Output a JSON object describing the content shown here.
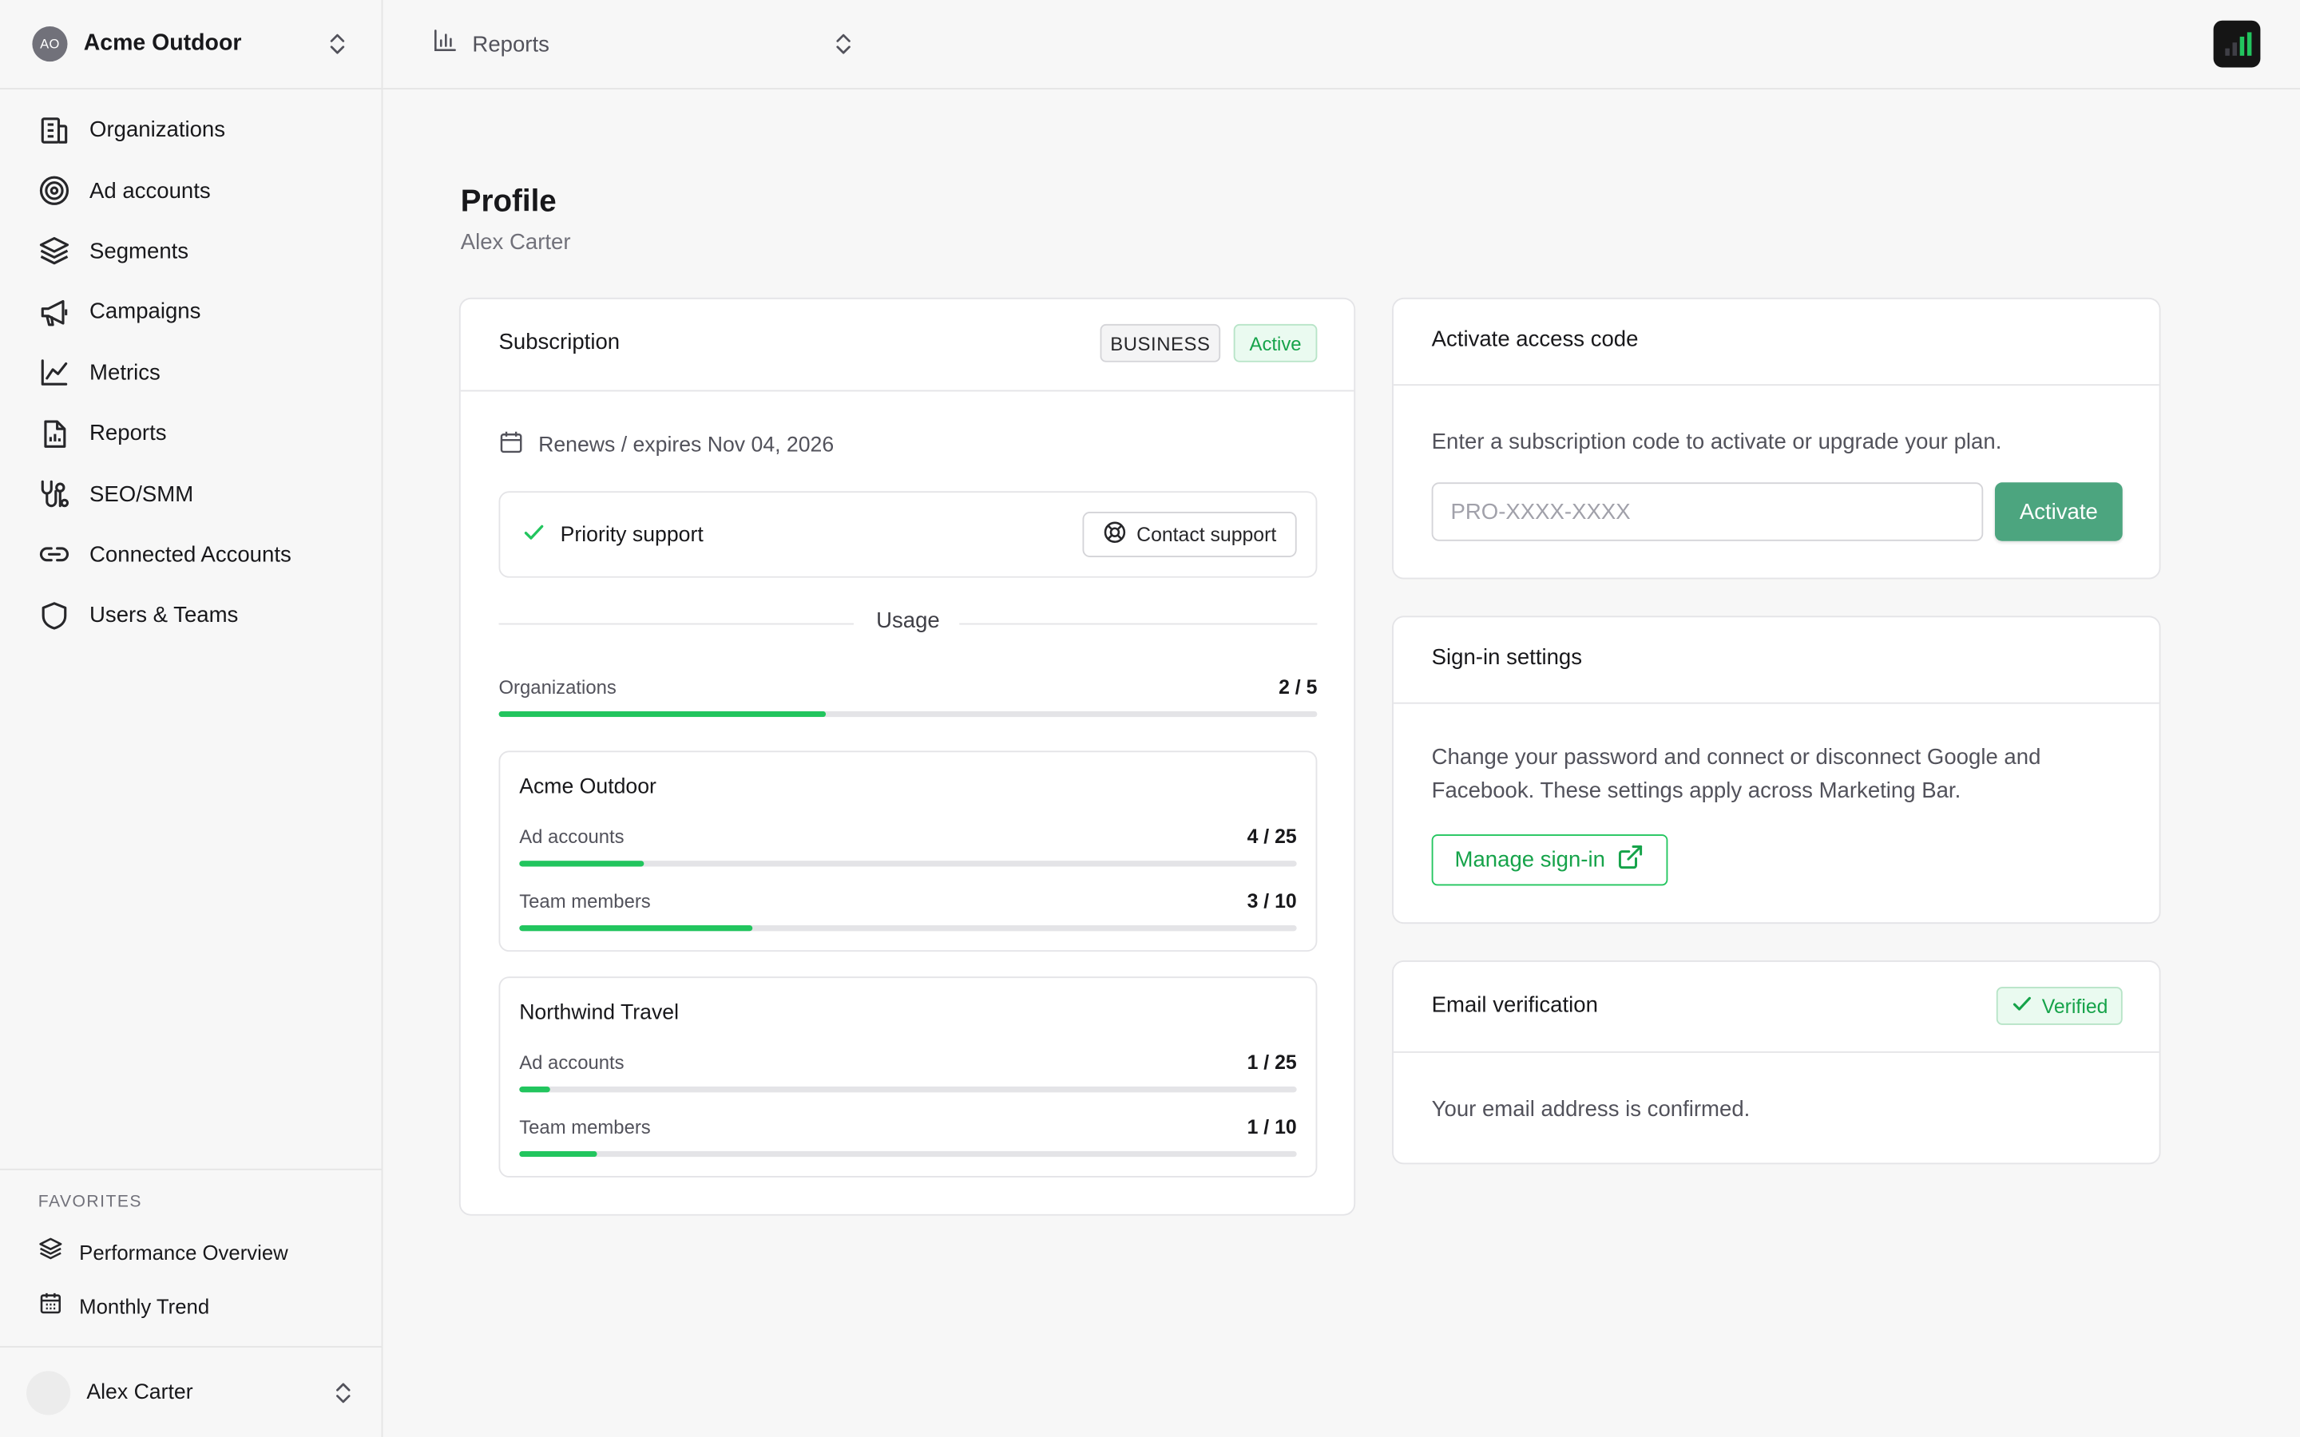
{
  "sidebar": {
    "org": {
      "initials": "AO",
      "name": "Acme Outdoor"
    },
    "nav": [
      {
        "label": "Organizations",
        "icon": "building-icon"
      },
      {
        "label": "Ad accounts",
        "icon": "target-icon"
      },
      {
        "label": "Segments",
        "icon": "layers-icon"
      },
      {
        "label": "Campaigns",
        "icon": "megaphone-icon"
      },
      {
        "label": "Metrics",
        "icon": "line-chart-icon"
      },
      {
        "label": "Reports",
        "icon": "report-file-icon"
      },
      {
        "label": "SEO/SMM",
        "icon": "seo-icon"
      },
      {
        "label": "Connected Accounts",
        "icon": "link-icon"
      },
      {
        "label": "Users & Teams",
        "icon": "shield-icon"
      }
    ],
    "favorites": {
      "title": "FAVORITES",
      "items": [
        {
          "label": "Performance Overview",
          "icon": "layers-icon"
        },
        {
          "label": "Monthly Trend",
          "icon": "calendar-icon"
        }
      ]
    },
    "user": {
      "name": "Alex Carter"
    }
  },
  "topbar": {
    "report_selector": "Reports"
  },
  "page": {
    "title": "Profile",
    "subtitle": "Alex Carter"
  },
  "subscription": {
    "title": "Subscription",
    "plan_badge": "BUSINESS",
    "status_badge": "Active",
    "renewal": "Renews / expires Nov 04, 2026",
    "feature": "Priority support",
    "contact_button": "Contact support",
    "usage_title": "Usage",
    "organizations": {
      "label": "Organizations",
      "value": "2 / 5",
      "used": 2,
      "limit": 5
    },
    "orgs": [
      {
        "name": "Acme Outdoor",
        "ad_accounts": {
          "label": "Ad accounts",
          "value": "4 / 25",
          "used": 4,
          "limit": 25
        },
        "team_members": {
          "label": "Team members",
          "value": "3 / 10",
          "used": 3,
          "limit": 10
        }
      },
      {
        "name": "Northwind Travel",
        "ad_accounts": {
          "label": "Ad accounts",
          "value": "1 / 25",
          "used": 1,
          "limit": 25
        },
        "team_members": {
          "label": "Team members",
          "value": "1 / 10",
          "used": 1,
          "limit": 10
        }
      }
    ]
  },
  "access_code": {
    "title": "Activate access code",
    "description": "Enter a subscription code to activate or upgrade your plan.",
    "placeholder": "PRO-XXXX-XXXX",
    "button": "Activate"
  },
  "signin": {
    "title": "Sign-in settings",
    "description_line1": "Change your password and connect or disconnect Google and",
    "description_line2": "Facebook. These settings apply across Marketing Bar.",
    "button": "Manage sign-in"
  },
  "email": {
    "title": "Email verification",
    "badge": "Verified",
    "description": "Your email address is confirmed."
  },
  "colors": {
    "accent": "#22c55e",
    "primary_button": "#4ca57f",
    "border": "#e4e4e7",
    "background": "#f7f7f7"
  }
}
